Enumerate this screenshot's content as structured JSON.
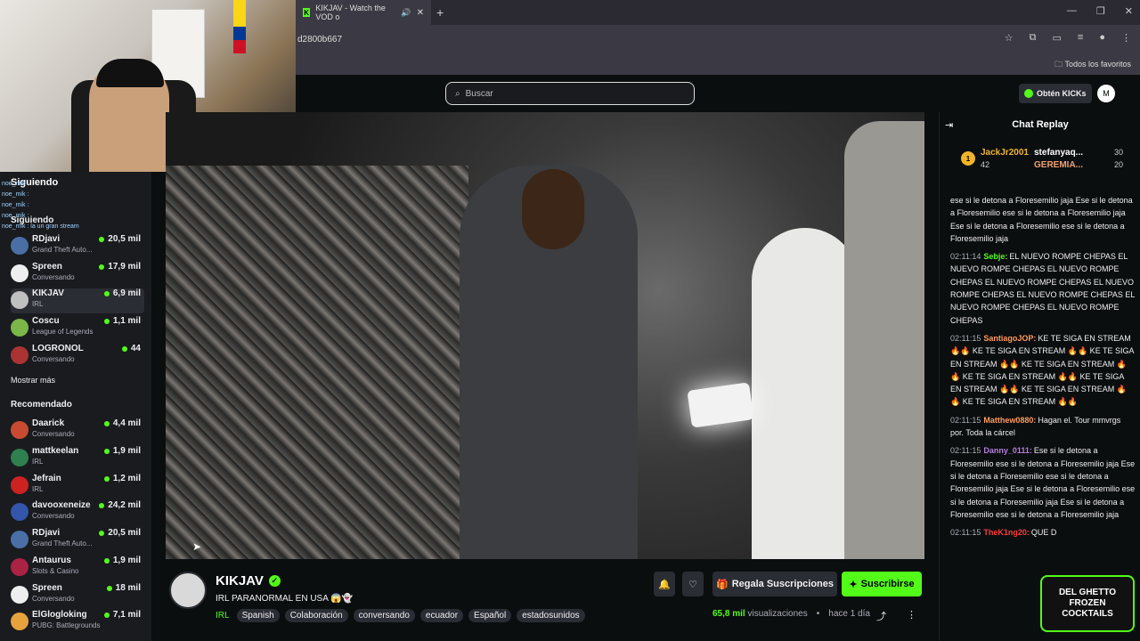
{
  "browser": {
    "tab_title": "KIKJAV - Watch the VOD o",
    "tab_favicon": "K",
    "url": "d2800b667",
    "bookmarks_label": "Todos los favoritos"
  },
  "nav": {
    "search_placeholder": "Buscar",
    "kicks_label": "Obtén KICKs",
    "user_initial": "M"
  },
  "sidebar": {
    "following_title": "Siguiendo",
    "following": [
      {
        "name": "RDjavi",
        "category": "Grand Theft Auto...",
        "viewers": "20,5 mil",
        "color": "#4a6fa5"
      },
      {
        "name": "Spreen",
        "category": "Conversando",
        "viewers": "17,9 mil",
        "color": "#eeeeee"
      },
      {
        "name": "KIKJAV",
        "category": "IRL",
        "viewers": "6,9 mil",
        "color": "#c0c0c0"
      },
      {
        "name": "Coscu",
        "category": "League of Legends",
        "viewers": "1,1 mil",
        "color": "#7ab648"
      },
      {
        "name": "LOGRONOL",
        "category": "Conversando",
        "viewers": "44",
        "color": "#aa3333"
      }
    ],
    "show_more": "Mostrar más",
    "recommended_title": "Recomendado",
    "recommended": [
      {
        "name": "Daarick",
        "category": "Conversando",
        "viewers": "4,4 mil",
        "color": "#c84b31"
      },
      {
        "name": "mattkeelan",
        "category": "IRL",
        "viewers": "1,9 mil",
        "color": "#2f7f4f"
      },
      {
        "name": "Jefrain",
        "category": "IRL",
        "viewers": "1,2 mil",
        "color": "#cc2222"
      },
      {
        "name": "davooxeneize",
        "category": "Conversando",
        "viewers": "24,2 mil",
        "color": "#3355aa"
      },
      {
        "name": "RDjavi",
        "category": "Grand Theft Auto...",
        "viewers": "20,5 mil",
        "color": "#4a6fa5"
      },
      {
        "name": "Antaurus",
        "category": "Slots & Casino",
        "viewers": "1,9 mil",
        "color": "#aa2244"
      },
      {
        "name": "Spreen",
        "category": "Conversando",
        "viewers": "18 mil",
        "color": "#eeeeee"
      },
      {
        "name": "ElGlogloking",
        "category": "PUBG: Battlegrounds",
        "viewers": "7,1 mil",
        "color": "#e6a23c"
      }
    ],
    "mini_chat": [
      "noe_mik :",
      "noe_mik :",
      "noe_mik :",
      "noe_mik :",
      "noe_mik : la un gran stream"
    ]
  },
  "stream": {
    "channel": "KIKJAV",
    "title": "IRL PARANORMAL EN USA 😱👻",
    "category": "IRL",
    "tags": [
      "Spanish",
      "Colaboración",
      "conversando",
      "ecuador",
      "Español",
      "estadosunidos"
    ],
    "gift_label": "Regala Suscripciones",
    "subscribe_label": "Suscribirse",
    "views_number": "65,8 mil",
    "views_label": "visualizaciones",
    "time_ago": "hace 1 día"
  },
  "chat": {
    "title": "Chat Replay",
    "leaderboard": {
      "first_name": "JackJr2001",
      "first_value": "42",
      "second_name": "stefanyaq...",
      "second_value": "30",
      "third_name": "GEREMIA...",
      "third_value": "20"
    },
    "messages": [
      {
        "time": "",
        "user": "",
        "color": "#efeff1",
        "text": "ese si le detona a Floresemilio jaja Ese si le detona a Floresemilio ese si le detona a Floresemilio jaja Ese si le detona a Floresemilio ese si le detona a Floresemilio jaja"
      },
      {
        "time": "02:11:14",
        "user": "Sebje:",
        "color": "#53fc18",
        "text": "EL NUEVO ROMPE CHEPAS EL NUEVO ROMPE CHEPAS EL NUEVO ROMPE CHEPAS EL NUEVO ROMPE CHEPAS EL NUEVO ROMPE CHEPAS EL NUEVO ROMPE CHEPAS EL NUEVO ROMPE CHEPAS EL NUEVO ROMPE CHEPAS"
      },
      {
        "time": "02:11:15",
        "user": "SantiagoJOP:",
        "color": "#ff9b5c",
        "text": "KE TE SIGA EN STREAM 🔥🔥 KE TE SIGA EN STREAM 🔥🔥 KE TE SIGA EN STREAM 🔥🔥 KE TE SIGA EN STREAM 🔥🔥 KE TE SIGA EN STREAM 🔥🔥 KE TE SIGA EN STREAM 🔥🔥 KE TE SIGA EN STREAM 🔥🔥 KE TE SIGA EN STREAM 🔥🔥"
      },
      {
        "time": "02:11:15",
        "user": "Matthew0880:",
        "color": "#ff9b5c",
        "text": "Hagan el. Tour mmvrgs por. Toda la cárcel"
      },
      {
        "time": "02:11:15",
        "user": "Danny_0111:",
        "color": "#b57edc",
        "text": "Ese si le detona a Floresemilio ese si le detona a Floresemilio jaja Ese si le detona a Floresemilio ese si le detona a Floresemilio jaja Ese si le detona a Floresemilio ese si le detona a Floresemilio jaja Ese si le detona a Floresemilio ese si le detona a Floresemilio jaja"
      },
      {
        "time": "02:11:15",
        "user": "TheK1ng20:",
        "color": "#ff3b3b",
        "text": "QUE D"
      }
    ]
  },
  "watermark": {
    "line1": "DEL GHETTO",
    "line2": "FROZEN",
    "line3": "COCKTAILS"
  }
}
